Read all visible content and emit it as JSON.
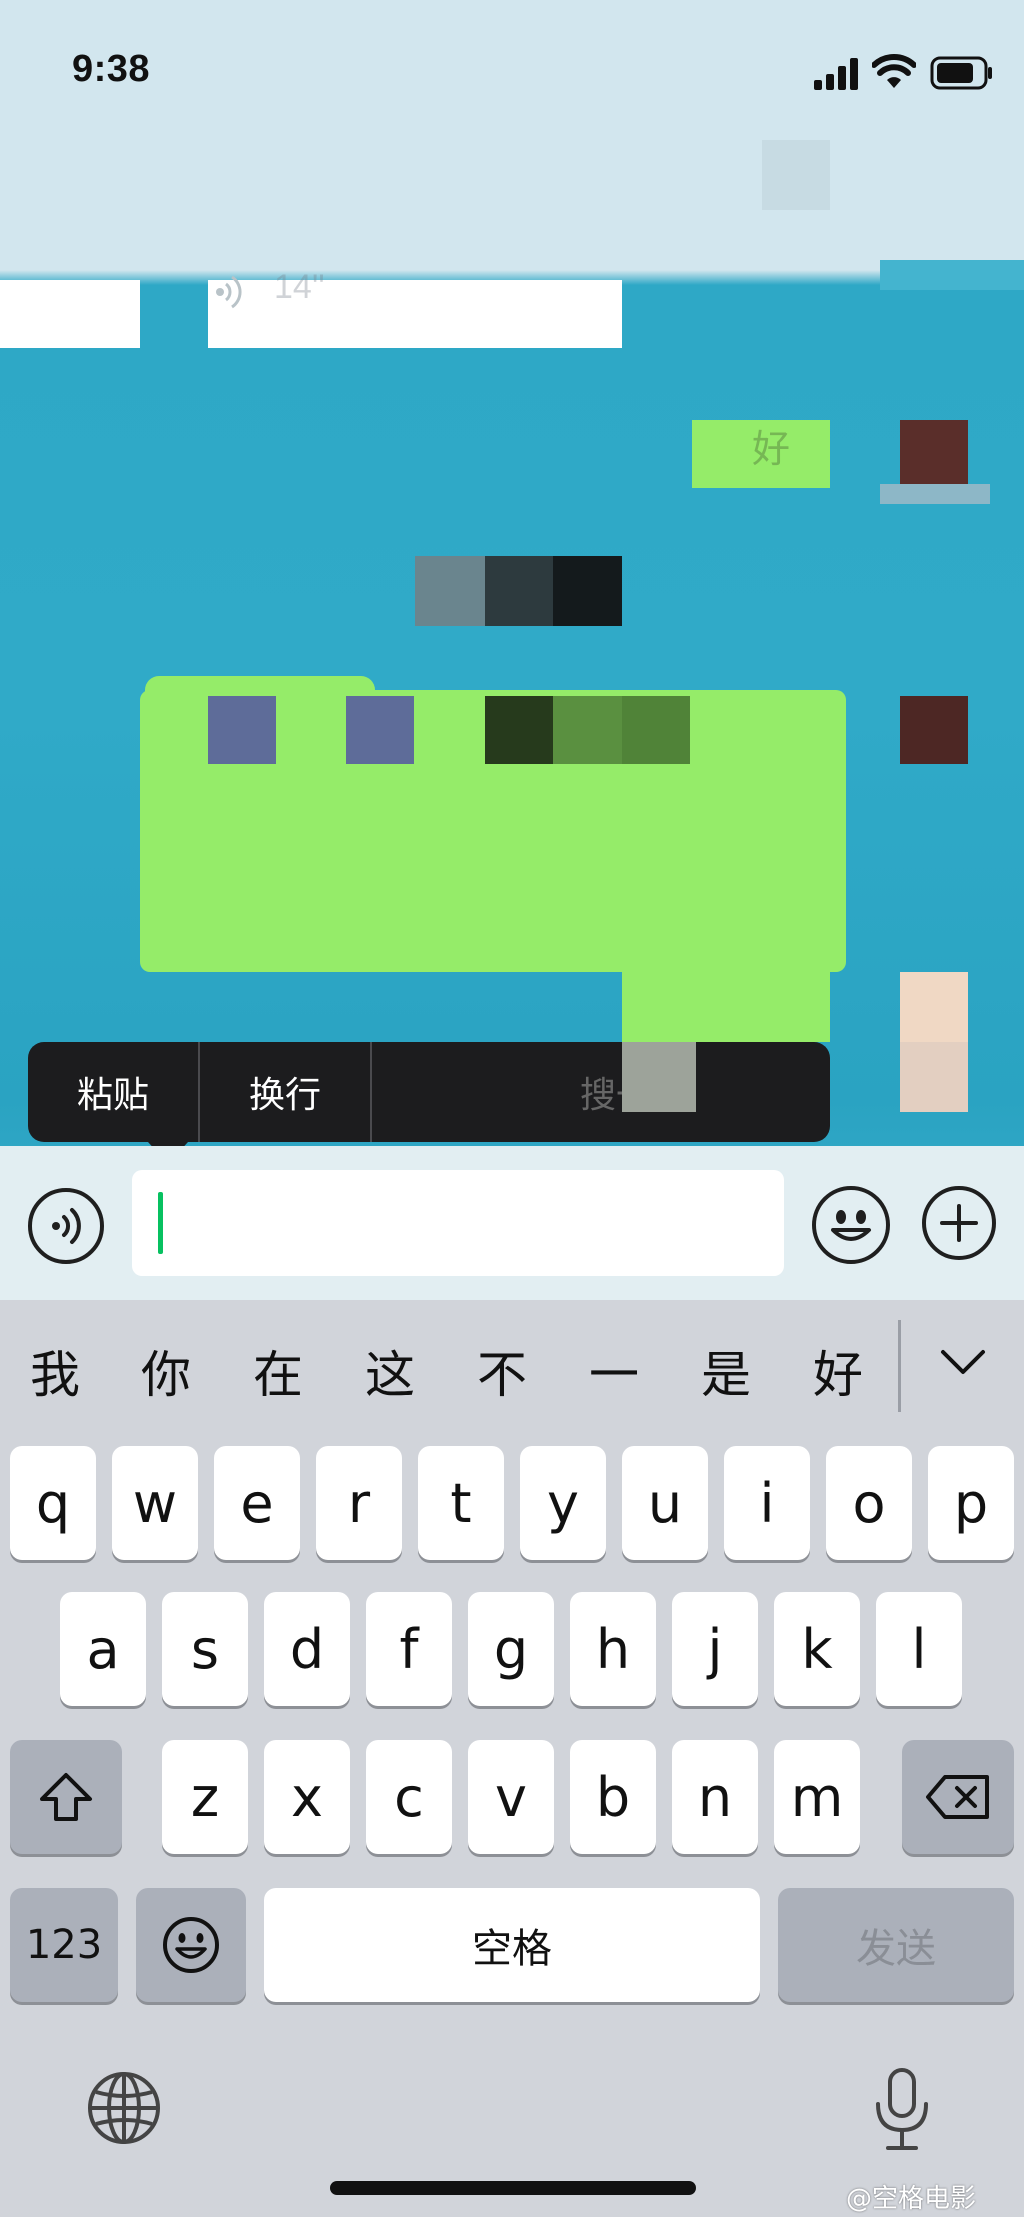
{
  "status_bar": {
    "time": "9:38"
  },
  "chat": {
    "header_title": "",
    "voice_message": {
      "duration": "14''"
    },
    "messages": [
      {
        "text": "好"
      }
    ]
  },
  "context_menu": {
    "items": [
      "粘贴",
      "换行",
      "",
      "搜一搜"
    ]
  },
  "input_bar": {
    "value": "",
    "voice_icon": "voice-waves-icon",
    "emoji_icon": "smiley-face-icon",
    "more_icon": "plus-icon"
  },
  "keyboard": {
    "candidates": [
      "我",
      "你",
      "在",
      "这",
      "不",
      "一",
      "是",
      "好"
    ],
    "row1": [
      "q",
      "w",
      "e",
      "r",
      "t",
      "y",
      "u",
      "i",
      "o",
      "p"
    ],
    "row2": [
      "a",
      "s",
      "d",
      "f",
      "g",
      "h",
      "j",
      "k",
      "l"
    ],
    "row3": [
      "z",
      "x",
      "c",
      "v",
      "b",
      "n",
      "m"
    ],
    "numbers_label": "123",
    "space_label": "空格",
    "send_label": "发送"
  },
  "watermark": "@空格电影",
  "colors": {
    "chat_bg": "#2ea8c6",
    "bubble_green": "#95ec69",
    "cursor": "#07c160",
    "menu_bg": "#1c1c1e",
    "keyboard_bg": "#d1d4da"
  }
}
